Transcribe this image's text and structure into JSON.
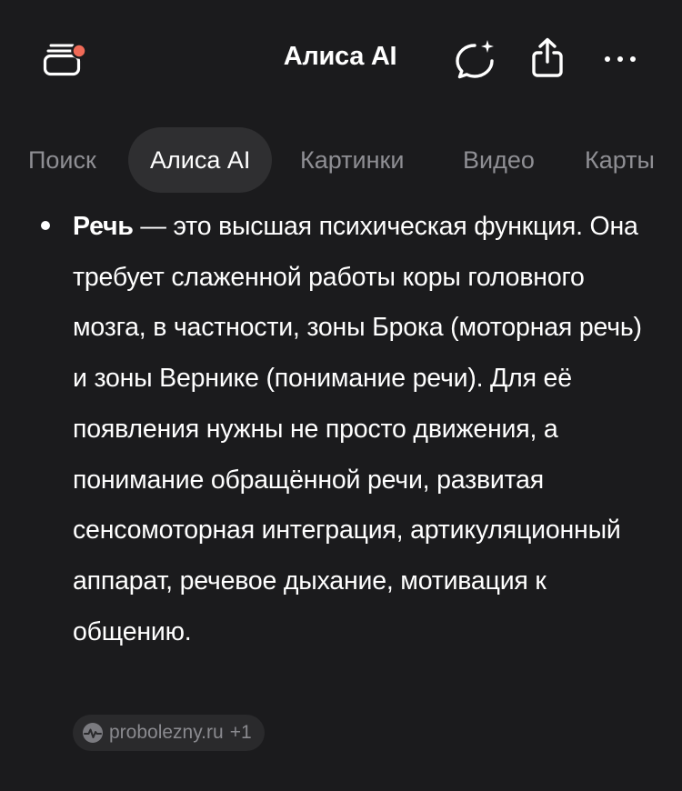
{
  "header": {
    "title": "Алиса AI",
    "icons": [
      "tabs-icon",
      "new-chat-icon",
      "share-icon",
      "more-icon"
    ],
    "notification_dot_color": "#f06a57"
  },
  "tabs": [
    {
      "label": "Поиск",
      "active": false
    },
    {
      "label": "Алиса AI",
      "active": true
    },
    {
      "label": "Картинки",
      "active": false
    },
    {
      "label": "Видео",
      "active": false
    },
    {
      "label": "Карты",
      "active": false
    }
  ],
  "content": {
    "term": "Речь",
    "text": " — это высшая психическая функция. Она требует слаженной работы коры головного мозга, в частности, зоны Брока (моторная речь) и зоны Вернике (понимание речи). Для её появления нужны не просто движения, а понимание обращённой речи, развитая сенсомоторная интеграция, артикуляционный аппарат, речевое дыхание, мотивация к общению."
  },
  "source": {
    "label": "probolezny.ru",
    "extra": "+1"
  }
}
